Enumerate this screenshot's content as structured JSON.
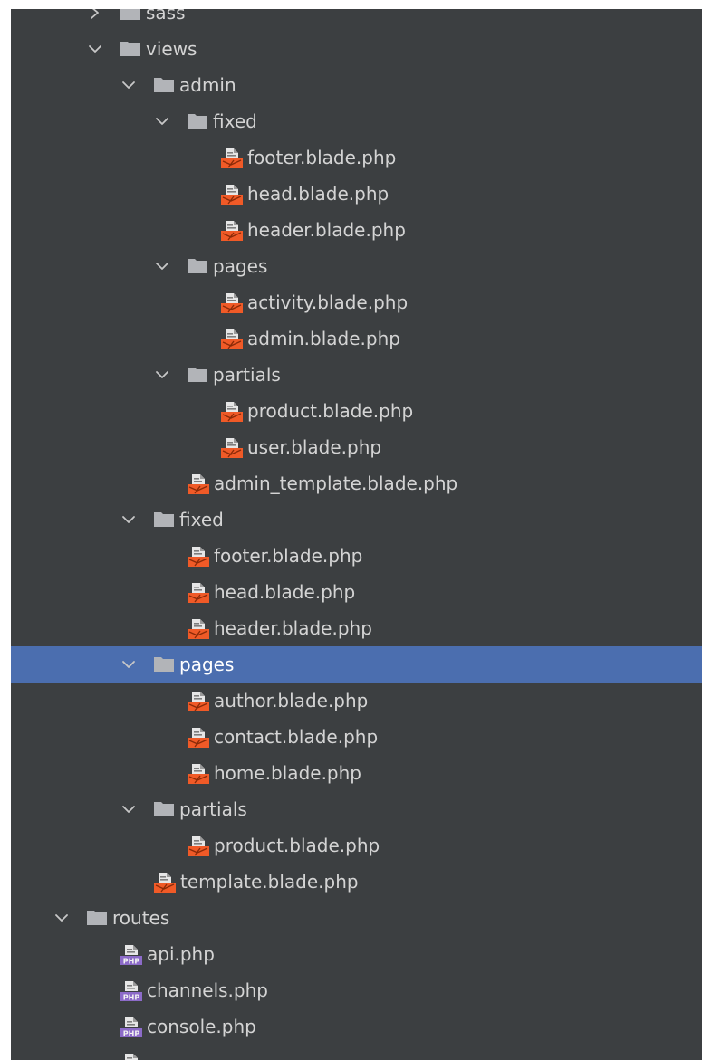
{
  "tree": [
    {
      "label": "sass",
      "kind": "folder",
      "depth": 0,
      "expanded": false
    },
    {
      "label": "views",
      "kind": "folder",
      "depth": 0,
      "expanded": true
    },
    {
      "label": "admin",
      "kind": "folder",
      "depth": 1,
      "expanded": true
    },
    {
      "label": "fixed",
      "kind": "folder",
      "depth": 2,
      "expanded": true
    },
    {
      "label": "footer.blade.php",
      "kind": "blade",
      "depth": 3
    },
    {
      "label": "head.blade.php",
      "kind": "blade",
      "depth": 3
    },
    {
      "label": "header.blade.php",
      "kind": "blade",
      "depth": 3
    },
    {
      "label": "pages",
      "kind": "folder",
      "depth": 2,
      "expanded": true
    },
    {
      "label": "activity.blade.php",
      "kind": "blade",
      "depth": 3
    },
    {
      "label": "admin.blade.php",
      "kind": "blade",
      "depth": 3
    },
    {
      "label": "partials",
      "kind": "folder",
      "depth": 2,
      "expanded": true
    },
    {
      "label": "product.blade.php",
      "kind": "blade",
      "depth": 3
    },
    {
      "label": "user.blade.php",
      "kind": "blade",
      "depth": 3
    },
    {
      "label": "admin_template.blade.php",
      "kind": "blade",
      "depth": 2
    },
    {
      "label": "fixed",
      "kind": "folder",
      "depth": 1,
      "expanded": true
    },
    {
      "label": "footer.blade.php",
      "kind": "blade",
      "depth": 2
    },
    {
      "label": "head.blade.php",
      "kind": "blade",
      "depth": 2
    },
    {
      "label": "header.blade.php",
      "kind": "blade",
      "depth": 2
    },
    {
      "label": "pages",
      "kind": "folder",
      "depth": 1,
      "expanded": true,
      "selected": true
    },
    {
      "label": "author.blade.php",
      "kind": "blade",
      "depth": 2
    },
    {
      "label": "contact.blade.php",
      "kind": "blade",
      "depth": 2
    },
    {
      "label": "home.blade.php",
      "kind": "blade",
      "depth": 2
    },
    {
      "label": "partials",
      "kind": "folder",
      "depth": 1,
      "expanded": true
    },
    {
      "label": "product.blade.php",
      "kind": "blade",
      "depth": 2
    },
    {
      "label": "template.blade.php",
      "kind": "blade",
      "depth": 1
    },
    {
      "label": "routes",
      "kind": "folder",
      "depth": -1,
      "expanded": true
    },
    {
      "label": "api.php",
      "kind": "php",
      "depth": 0
    },
    {
      "label": "channels.php",
      "kind": "php",
      "depth": 0
    },
    {
      "label": "console.php",
      "kind": "php",
      "depth": 0
    },
    {
      "label": "",
      "kind": "php",
      "depth": 0
    }
  ],
  "colors": {
    "panel": "#3c3f41",
    "selection": "#4b6eaf",
    "text": "#d4d4d4",
    "folder": "#b2b4b8",
    "blade": "#f05a27",
    "php": "#8c6bc8"
  }
}
